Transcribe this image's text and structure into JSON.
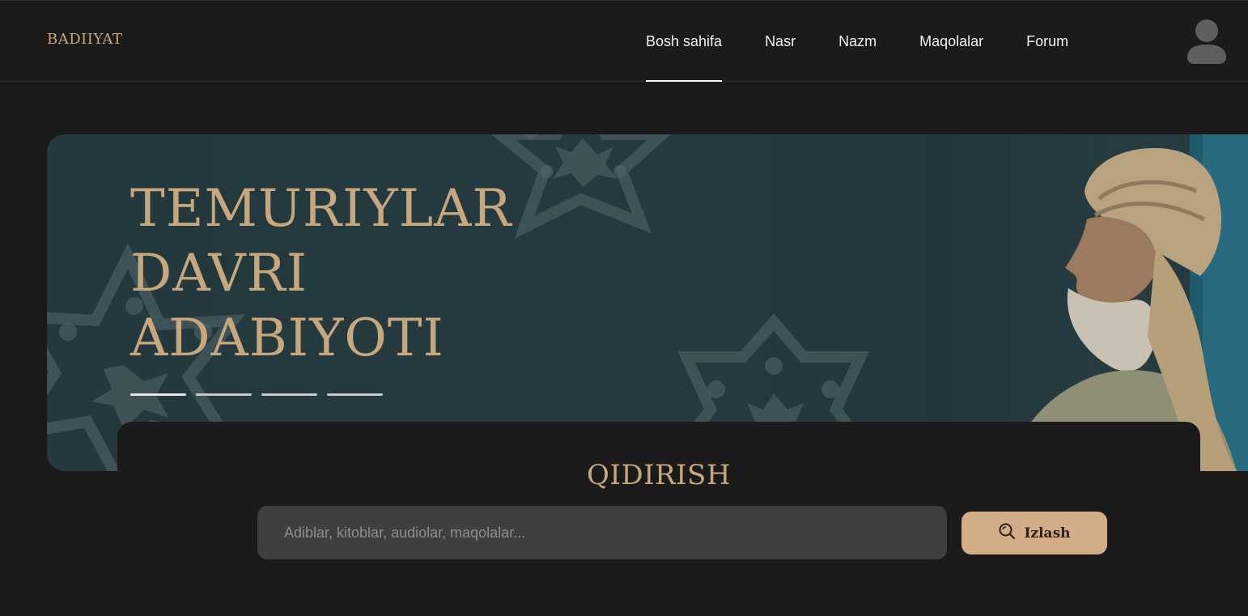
{
  "header": {
    "logo": "Badiiyat",
    "nav": [
      {
        "label": "Bosh sahifa",
        "active": true
      },
      {
        "label": "Nasr",
        "active": false
      },
      {
        "label": "Nazm",
        "active": false
      },
      {
        "label": "Maqolalar",
        "active": false
      },
      {
        "label": "Forum",
        "active": false
      }
    ],
    "avatar_icon": "user-avatar-icon"
  },
  "hero": {
    "title_line1": "Temuriylar",
    "title_line2": "davri",
    "title_line3": "adabiyoti",
    "slides": 4,
    "active_slide": 1
  },
  "search": {
    "title": "Qidirish",
    "placeholder": "Adiblar, kitoblar, audiolar, maqolalar...",
    "value": "",
    "button_label": "Izlash",
    "button_icon": "search-icon"
  },
  "colors": {
    "background": "#1a1a1a",
    "accent": "#c7a77e",
    "button": "#d3ad88",
    "hero": "#24393e"
  }
}
